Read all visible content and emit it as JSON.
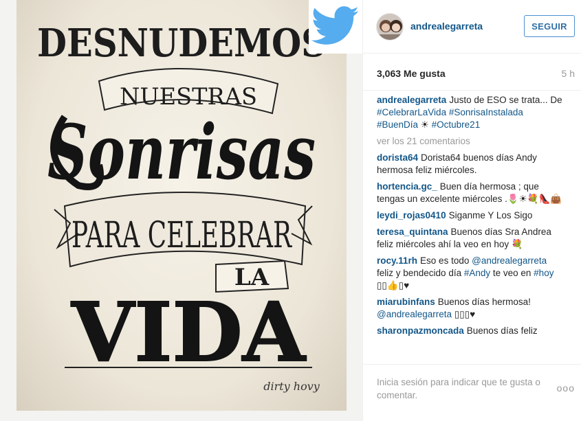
{
  "post": {
    "image_text": {
      "line1": "DESNUDEMOS",
      "line2": "NUESTRAS",
      "line3": "Sonrisas",
      "line4": "PARA CELEBRAR",
      "line5": "LA",
      "line6": "VIDA",
      "signature": "dirty hovy"
    }
  },
  "header": {
    "username": "andrealegarreta",
    "follow_label": "SEGUIR"
  },
  "stats": {
    "likes": "3,063 Me gusta",
    "time": "5 h"
  },
  "caption": {
    "user": "andrealegarreta",
    "text_start": "Justo de ESO se trata... De ",
    "tag1": "#CelebrarLaVida",
    "tag2": "#SonrisaInstalada",
    "tag3": "#BuenDía",
    "sun": " ☀ ",
    "tag4": "#Octubre21"
  },
  "view_all": "ver los 21 comentarios",
  "comments": [
    {
      "user": "dorista64",
      "text": "Dorista64 buenos días Andy hermosa feliz miércoles."
    },
    {
      "user": "hortencia.gc_",
      "text": "Buen día hermosa ; que tengas un excelente miércoles .🌷☀💐👠👜"
    },
    {
      "user": "leydi_rojas0410",
      "text": "Siganme Y Los Sigo"
    },
    {
      "user": "teresa_quintana",
      "text": "Buenos días Sra Andrea feliz miércoles ahí la veo en hoy 💐"
    },
    {
      "user": "rocy.11rh",
      "text_a": "Eso es todo ",
      "mention": "@andrealegarreta",
      "text_b": " feliz y bendecido día ",
      "tag_a": "#Andy",
      "text_c": " te veo en ",
      "tag_b": "#hoy",
      "text_d": " ▯▯👍▯♥"
    },
    {
      "user": "miarubinfans",
      "text_a": "Buenos días hermosa! ",
      "mention": "@andrealegarreta",
      "text_b": " ▯▯▯♥"
    },
    {
      "user": "sharonpazmoncada",
      "text": "Buenos días feliz"
    }
  ],
  "footer": {
    "login_text": "Inicia sesión para indicar que te gusta o comentar.",
    "more_label": "ooo"
  },
  "colors": {
    "link": "#125688",
    "twitter": "#55acee",
    "follow_border": "#4a8fd0"
  },
  "icons": [
    "twitter-bird-icon",
    "more-options-icon"
  ]
}
